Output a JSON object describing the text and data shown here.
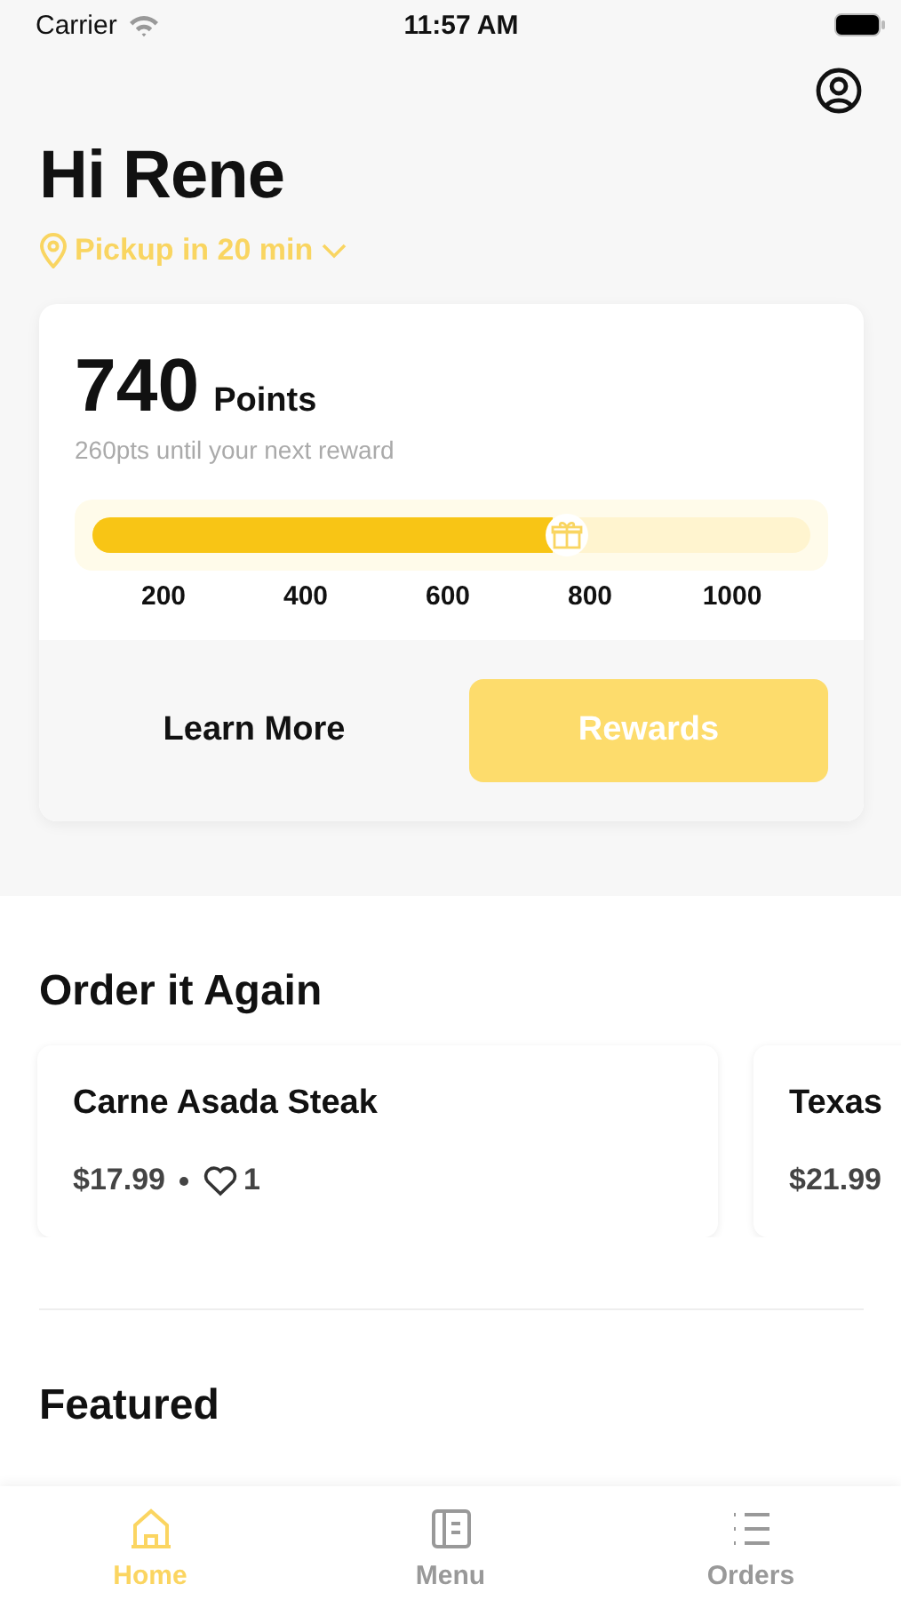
{
  "status_bar": {
    "carrier": "Carrier",
    "time": "11:57 AM"
  },
  "greeting": "Hi Rene",
  "pickup": "Pickup in 20 min",
  "rewards_card": {
    "points": "740",
    "points_label": "Points",
    "subtitle": "260pts until your next reward",
    "level": 0.64,
    "ticks": [
      "200",
      "400",
      "600",
      "800",
      "1000"
    ],
    "buttons": [
      {
        "label": "Learn More",
        "kind": "plain"
      },
      {
        "label": "Rewards",
        "kind": "primary"
      }
    ]
  },
  "order_again": {
    "title": "Order it Again",
    "items": [
      {
        "name": "Carne Asada Steak",
        "price": "$17.99",
        "likes": "1"
      },
      {
        "name": "Texas",
        "price": "$21.99"
      }
    ]
  },
  "featured": {
    "title": "Featured"
  },
  "tabs": [
    {
      "label": "Home",
      "kind": "home",
      "selected": true
    },
    {
      "label": "Menu",
      "kind": "menu",
      "selected": false
    },
    {
      "label": "Orders",
      "kind": "list",
      "selected": false
    }
  ]
}
